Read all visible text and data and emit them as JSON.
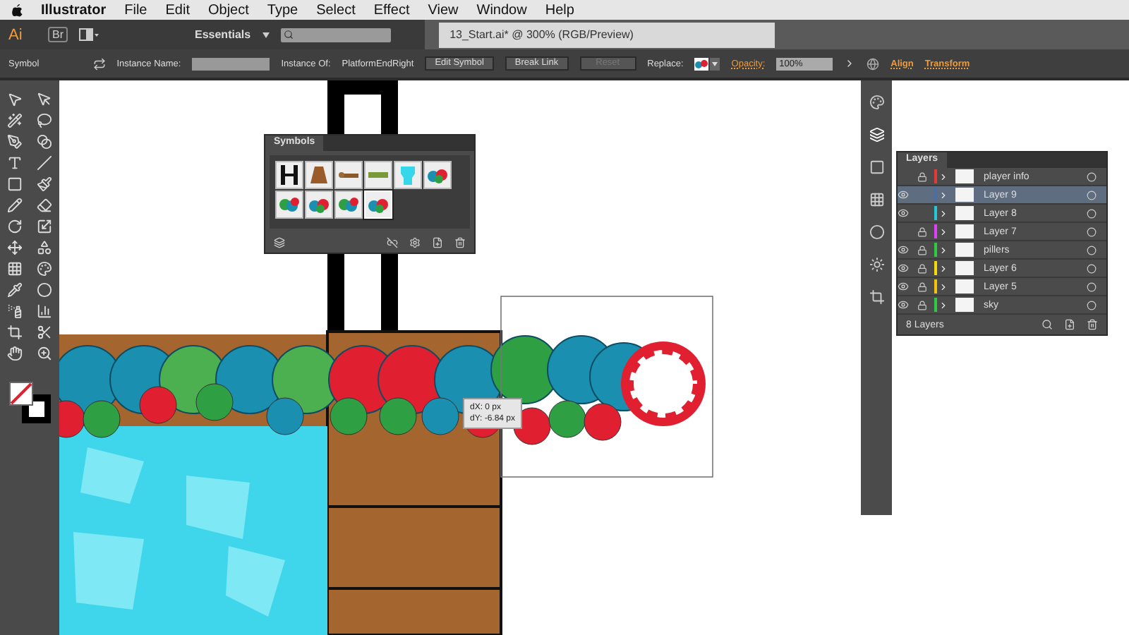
{
  "menu_bar": {
    "items": [
      "Illustrator",
      "File",
      "Edit",
      "Object",
      "Type",
      "Select",
      "Effect",
      "View",
      "Window",
      "Help"
    ]
  },
  "app_bar": {
    "logo": "Ai",
    "bridge": "Br",
    "workspace": "Essentials",
    "document_tab": "13_Start.ai* @ 300% (RGB/Preview)"
  },
  "control_bar": {
    "selection_type": "Symbol",
    "instance_name_label": "Instance Name:",
    "instance_of_label": "Instance Of:",
    "instance_of": "PlatformEndRight",
    "buttons": [
      {
        "label": "Edit Symbol",
        "disabled": false
      },
      {
        "label": "Break Link",
        "disabled": false
      },
      {
        "label": "Reset",
        "disabled": true
      }
    ],
    "replace_label": "Replace:",
    "opacity_label": "Opacity:",
    "opacity": "100%",
    "links": [
      "Align",
      "Transform"
    ]
  },
  "symbols_panel": {
    "title": "Symbols",
    "symbols": [
      {
        "kind": "pillar",
        "selected": false
      },
      {
        "kind": "trapezoid",
        "selected": false
      },
      {
        "kind": "platform-end",
        "selected": false
      },
      {
        "kind": "platform",
        "selected": false
      },
      {
        "kind": "ice",
        "selected": false
      },
      {
        "kind": "candy",
        "selected": false
      },
      {
        "kind": "balls",
        "selected": false
      },
      {
        "kind": "candy",
        "selected": false
      },
      {
        "kind": "balls",
        "selected": false
      },
      {
        "kind": "candy",
        "selected": true
      }
    ]
  },
  "move_tooltip": {
    "dx": "dX: 0 px",
    "dy": "dY: -6.84 px"
  },
  "layers_panel": {
    "title": "Layers",
    "layers": [
      {
        "name": "player info",
        "color": "#e53935",
        "visible": false,
        "locked": true,
        "selected": false
      },
      {
        "name": "Layer 9",
        "color": "#4a6fa5",
        "visible": true,
        "locked": false,
        "selected": true
      },
      {
        "name": "Layer 8",
        "color": "#26c6da",
        "visible": true,
        "locked": false,
        "selected": false
      },
      {
        "name": "Layer 7",
        "color": "#e040fb",
        "visible": false,
        "locked": true,
        "selected": false
      },
      {
        "name": "pillers",
        "color": "#2ecc40",
        "visible": true,
        "locked": true,
        "selected": false
      },
      {
        "name": "Layer 6",
        "color": "#f5d90a",
        "visible": true,
        "locked": true,
        "selected": false
      },
      {
        "name": "Layer 5",
        "color": "#f5c20a",
        "visible": true,
        "locked": true,
        "selected": false
      },
      {
        "name": "sky",
        "color": "#2ecc40",
        "visible": true,
        "locked": true,
        "selected": false
      }
    ],
    "count": "8 Layers"
  }
}
